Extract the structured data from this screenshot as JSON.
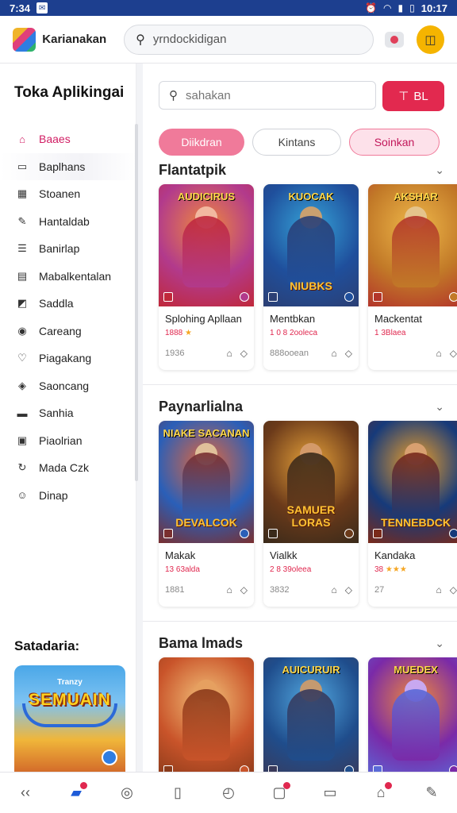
{
  "status_bar": {
    "time": "7:34",
    "clock": "10:17",
    "icons": [
      "alarm-icon",
      "wifi-icon",
      "signal-icon",
      "battery-icon"
    ]
  },
  "header": {
    "brand": "Karianakan",
    "search_value": "yrndockidigan"
  },
  "sidebar": {
    "title": "Toka Aplikingai",
    "items": [
      {
        "label": "Baaes",
        "icon": "bag-icon",
        "glyph": "⌂",
        "active": true
      },
      {
        "label": "Baplhans",
        "icon": "card-icon",
        "glyph": "▭"
      },
      {
        "label": "Stoanen",
        "icon": "grid-icon",
        "glyph": "▦"
      },
      {
        "label": "Hantaldab",
        "icon": "wrench-icon",
        "glyph": "✎"
      },
      {
        "label": "Banirlap",
        "icon": "list-icon",
        "glyph": "☰"
      },
      {
        "label": "Mabalkentalan",
        "icon": "calendar-icon",
        "glyph": "▤"
      },
      {
        "label": "Saddla",
        "icon": "chart-icon",
        "glyph": "◩"
      },
      {
        "label": "Careang",
        "icon": "circle-icon",
        "glyph": "◉"
      },
      {
        "label": "Piagakang",
        "icon": "heart-icon",
        "glyph": "♡"
      },
      {
        "label": "Saoncang",
        "icon": "puzzle-icon",
        "glyph": "◈"
      },
      {
        "label": "Sanhia",
        "icon": "book-icon",
        "glyph": "▬"
      },
      {
        "label": "Piaolrian",
        "icon": "tablet-icon",
        "glyph": "▣"
      },
      {
        "label": "Mada Czk",
        "icon": "refresh-icon",
        "glyph": "↻"
      },
      {
        "label": "Dinap",
        "icon": "smile-icon",
        "glyph": "☺"
      }
    ],
    "featured_label": "Satadaria:",
    "featured_card": {
      "title": "SEMUAIN",
      "sub": "Tranzy"
    }
  },
  "main": {
    "search_placeholder": "sahakan",
    "filter_label": "BL",
    "chips": [
      "Diikdran",
      "Kintans",
      "Soinkan"
    ],
    "sections": [
      {
        "title": "Flantatpik",
        "cards": [
          {
            "title": "Splohing Apllaan",
            "meta": "1888",
            "stars": "★",
            "count": "1936",
            "art_title": "AUDICIRUS",
            "art_bottom": "",
            "palette": [
              "#b23a8c",
              "#f08a3c",
              "#c0283a",
              "#f2b8a0"
            ]
          },
          {
            "title": "Mentbkan",
            "meta": "1 0 8 2ooleca",
            "stars": "",
            "count": "888ooean",
            "art_title": "KUOCAK",
            "art_bottom": "NIUBKS",
            "palette": [
              "#1f4f9c",
              "#36a4d8",
              "#2b3f74",
              "#c9a070"
            ]
          },
          {
            "title": "Mackentat",
            "meta": "1 3Blaea",
            "stars": "",
            "count": "",
            "art_title": "AKSHAR",
            "art_bottom": "",
            "palette": [
              "#c27a28",
              "#efb84a",
              "#b3352a",
              "#e5c48c"
            ]
          }
        ]
      },
      {
        "title": "Paynarlialna",
        "cards": [
          {
            "title": "Makak",
            "meta": "13 63alda",
            "stars": "",
            "count": "1881",
            "art_title": "NIAKE SACANAN",
            "art_bottom": "DEVALCOK",
            "palette": [
              "#2a5fb8",
              "#e5663a",
              "#7a2f2f",
              "#e0c09a"
            ]
          },
          {
            "title": "Vialkk",
            "meta": "2 8 39oleea",
            "stars": "",
            "count": "3832",
            "art_title": "",
            "art_bottom": "SAMUER LORAS",
            "palette": [
              "#6b3a1a",
              "#e6a23a",
              "#3a2a1a",
              "#d49a6a"
            ]
          },
          {
            "title": "Kandaka",
            "meta": "38",
            "stars": "★★★",
            "count": "27",
            "art_title": "",
            "art_bottom": "TENNEBDCK",
            "palette": [
              "#163a7a",
              "#f0a028",
              "#7a2a1a",
              "#d8a070"
            ]
          }
        ]
      },
      {
        "title": "Bama lmads",
        "cards": [
          {
            "title": "",
            "meta": "",
            "stars": "",
            "count": "",
            "art_title": "",
            "art_bottom": "",
            "palette": [
              "#c9542a",
              "#f3c27a",
              "#8a3a1a",
              "#e6a060"
            ]
          },
          {
            "title": "",
            "meta": "",
            "stars": "",
            "count": "",
            "art_title": "AUICURUIR",
            "art_bottom": "",
            "palette": [
              "#1f4d8c",
              "#52a8e0",
              "#3a3a5a",
              "#c49a70"
            ]
          },
          {
            "title": "",
            "meta": "",
            "stars": "",
            "count": "",
            "art_title": "MUEDEX",
            "art_bottom": "",
            "palette": [
              "#7a2aa8",
              "#f08a3a",
              "#5a6ad8",
              "#c8a8f0"
            ]
          }
        ]
      }
    ]
  },
  "bottom_nav": [
    {
      "name": "back-icon",
      "glyph": "‹‹"
    },
    {
      "name": "inbox-icon",
      "glyph": "▰",
      "blue": true,
      "badge": true
    },
    {
      "name": "basketball-icon",
      "glyph": "◎"
    },
    {
      "name": "phone-icon",
      "glyph": "▯"
    },
    {
      "name": "compass-icon",
      "glyph": "◴"
    },
    {
      "name": "notification-icon",
      "glyph": "▢",
      "badge": true
    },
    {
      "name": "window-icon",
      "glyph": "▭"
    },
    {
      "name": "shop-icon",
      "glyph": "⌂",
      "badge": true
    },
    {
      "name": "edit-icon",
      "glyph": "✎"
    }
  ],
  "colors": {
    "accent": "#e2294f",
    "status_bar": "#1d3f8f",
    "active_nav": "#d11d63",
    "profile": "#f5b400"
  }
}
